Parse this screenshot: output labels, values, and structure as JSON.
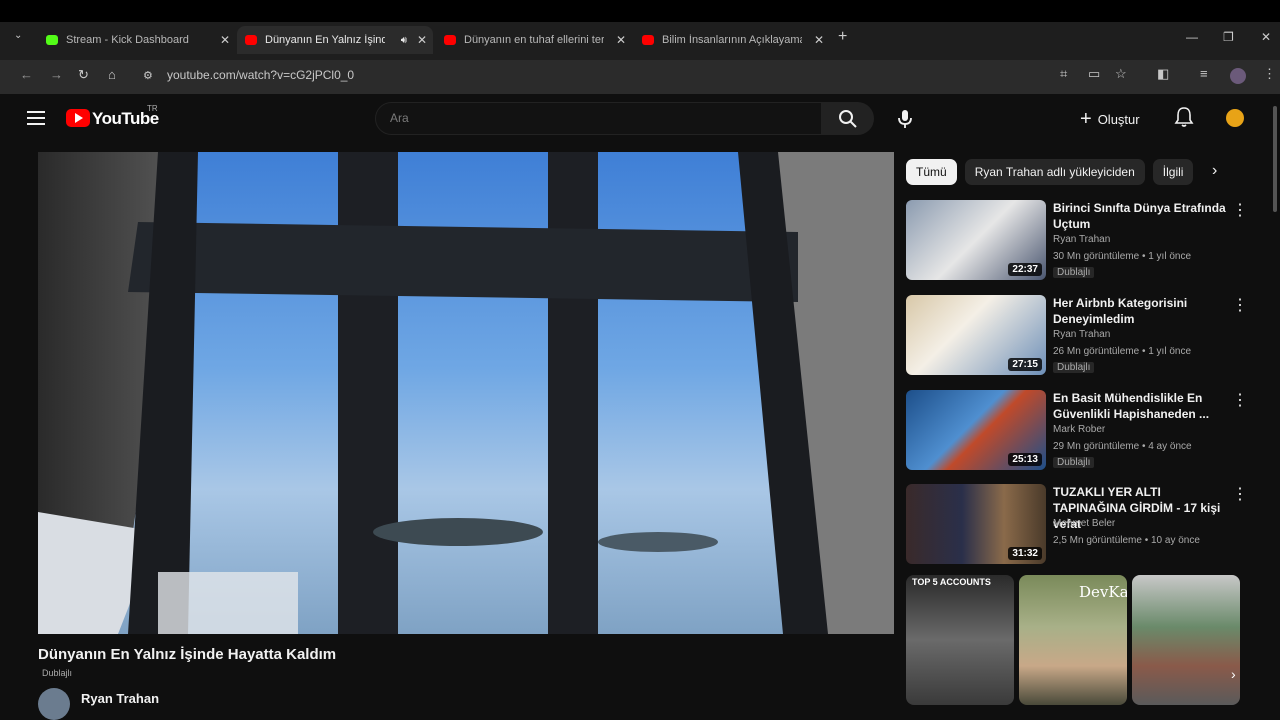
{
  "browser": {
    "tabs": [
      {
        "label": "Stream - Kick Dashboard",
        "color": "#53fc18"
      },
      {
        "label": "Dünyanın En Yalnız İşinde H",
        "color": "#ff0000"
      },
      {
        "label": "Dünyanın en tuhaf ellerini ter",
        "color": "#ff0000"
      },
      {
        "label": "Bilim İnsanlarının Açıklayamadı",
        "color": "#ff0000"
      }
    ],
    "url": "youtube.com/watch?v=cG2jPCl0_0"
  },
  "header": {
    "logo_text": "YouTube",
    "country": "TR",
    "search_placeholder": "Ara",
    "create_label": "Oluştur"
  },
  "video": {
    "title": "Dünyanın En Yalnız İşinde Hayatta Kaldım",
    "dubbed": "Dublajlı",
    "channel": "Ryan Trahan"
  },
  "chips": [
    "Tümü",
    "Ryan Trahan adlı yükleyiciden",
    "İlgili"
  ],
  "recommendations": [
    {
      "title": "Birinci Sınıfta Dünya Etrafında Uçtum",
      "channel": "Ryan Trahan",
      "meta": "30 Mn görüntüleme • 1 yıl önce",
      "badge": "Dublajlı",
      "duration": "22:37"
    },
    {
      "title": "Her Airbnb Kategorisini Deneyimledim",
      "channel": "Ryan Trahan",
      "meta": "26 Mn görüntüleme • 1 yıl önce",
      "badge": "Dublajlı",
      "duration": "27:15"
    },
    {
      "title": "En Basit Mühendislikle En Güvenlikli Hapishaneden ...",
      "channel": "Mark Rober",
      "meta": "29 Mn görüntüleme • 4 ay önce",
      "badge": "Dublajlı",
      "duration": "25:13"
    },
    {
      "title": "TUZAKLI YER ALTI TAPINAĞINA GİRDİM - 17 kişi vefat",
      "channel": "Mehmet Beler",
      "meta": "2,5 Mn görüntüleme • 10 ay önce",
      "badge": "",
      "duration": "31:32"
    }
  ],
  "shorts": {
    "short1_text": "TOP 5 ACCOUNTS",
    "short2_text": "DevKa"
  }
}
